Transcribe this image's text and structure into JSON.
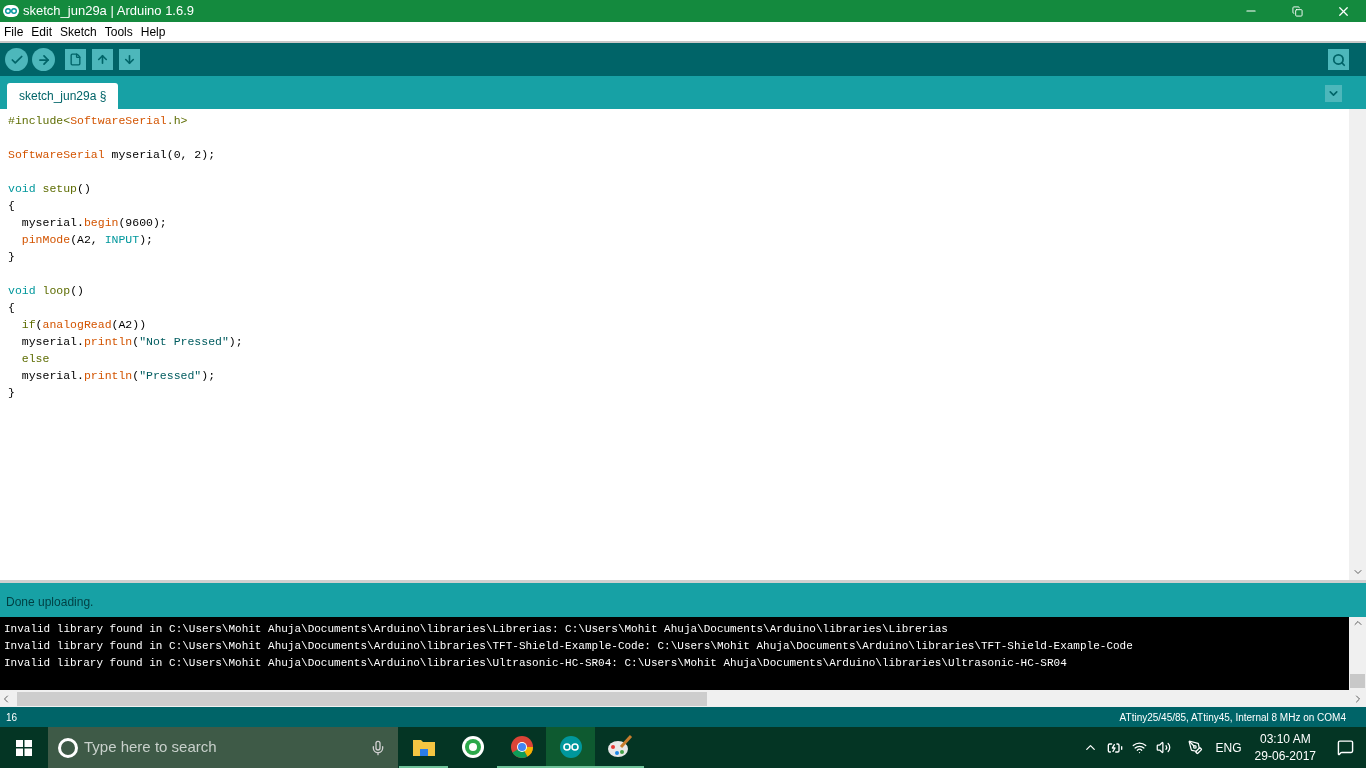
{
  "window": {
    "title": "sketch_jun29a | Arduino 1.6.9"
  },
  "menu": [
    "File",
    "Edit",
    "Sketch",
    "Tools",
    "Help"
  ],
  "tabs": [
    {
      "label": "sketch_jun29a §",
      "selected": true
    }
  ],
  "code": [
    {
      "kind": "code",
      "tokens": [
        {
          "kind": "keyword",
          "text": "#include<"
        },
        {
          "kind": "type",
          "text": "SoftwareSerial"
        },
        {
          "kind": "keyword",
          "text": ".h>"
        }
      ]
    },
    {
      "kind": "blank"
    },
    {
      "kind": "code",
      "tokens": [
        {
          "kind": "type",
          "text": "SoftwareSerial"
        },
        {
          "kind": "plain",
          "text": " myserial(0, 2);"
        }
      ]
    },
    {
      "kind": "blank"
    },
    {
      "kind": "code",
      "tokens": [
        {
          "kind": "datatype",
          "text": "void"
        },
        {
          "kind": "keyword",
          "text": " setup"
        },
        {
          "kind": "plain",
          "text": "()"
        }
      ]
    },
    {
      "tokens": [
        {
          "kind": "plain",
          "text": "{"
        }
      ]
    },
    {
      "tokens": [
        {
          "kind": "plain",
          "text": "  myserial."
        },
        {
          "kind": "type",
          "text": "begin"
        },
        {
          "kind": "plain",
          "text": "(9600);"
        }
      ]
    },
    {
      "kind": "code",
      "tokens": [
        {
          "kind": "type",
          "text": "  pinMode"
        },
        {
          "kind": "plain",
          "text": "(A2, "
        },
        {
          "kind": "datatype",
          "text": "INPUT"
        },
        {
          "kind": "plain",
          "text": ");"
        }
      ]
    },
    {
      "tokens": [
        {
          "kind": "plain",
          "text": "}"
        }
      ]
    },
    {
      "kind": "blank"
    },
    {
      "kind": "code",
      "tokens": [
        {
          "kind": "datatype",
          "text": "void"
        },
        {
          "kind": "keyword",
          "text": " loop"
        },
        {
          "kind": "plain",
          "text": "()"
        }
      ]
    },
    {
      "tokens": [
        {
          "kind": "plain",
          "text": "{"
        }
      ]
    },
    {
      "kind": "code",
      "tokens": [
        {
          "kind": "keyword",
          "text": "  if"
        },
        {
          "kind": "plain",
          "text": "("
        },
        {
          "kind": "type",
          "text": "analogRead"
        },
        {
          "kind": "plain",
          "text": "(A2))"
        }
      ]
    },
    {
      "tokens": [
        {
          "kind": "plain",
          "text": "  myserial."
        },
        {
          "kind": "type",
          "text": "println"
        },
        {
          "kind": "plain",
          "text": "("
        },
        {
          "kind": "string",
          "text": "\"Not Pressed\""
        },
        {
          "kind": "plain",
          "text": ");"
        }
      ]
    },
    {
      "kind": "code",
      "tokens": [
        {
          "kind": "keyword",
          "text": "  else"
        }
      ]
    },
    {
      "tokens": [
        {
          "kind": "plain",
          "text": "  myserial."
        },
        {
          "kind": "type",
          "text": "println"
        },
        {
          "kind": "plain",
          "text": "("
        },
        {
          "kind": "string",
          "text": "\"Pressed\""
        },
        {
          "kind": "plain",
          "text": ");"
        }
      ]
    },
    {
      "tokens": [
        {
          "kind": "plain",
          "text": "}"
        }
      ]
    }
  ],
  "status": "Done uploading.",
  "console": [
    "Invalid library found in C:\\Users\\Mohit Ahuja\\Documents\\Arduino\\libraries\\Librerias: C:\\Users\\Mohit Ahuja\\Documents\\Arduino\\libraries\\Librerias",
    "Invalid library found in C:\\Users\\Mohit Ahuja\\Documents\\Arduino\\libraries\\TFT-Shield-Example-Code: C:\\Users\\Mohit Ahuja\\Documents\\Arduino\\libraries\\TFT-Shield-Example-Code",
    "Invalid library found in C:\\Users\\Mohit Ahuja\\Documents\\Arduino\\libraries\\Ultrasonic-HC-SR04: C:\\Users\\Mohit Ahuja\\Documents\\Arduino\\libraries\\Ultrasonic-HC-SR04"
  ],
  "footer": {
    "line": "16",
    "board": "ATtiny25/45/85, ATtiny45, Internal 8 MHz on COM4"
  },
  "taskbar": {
    "search": {
      "placeholder": "Type here to search"
    },
    "apps": [
      {
        "kind": "folder",
        "running": true,
        "selected": false
      },
      {
        "kind": "chat",
        "running": false,
        "selected": false
      },
      {
        "kind": "browser",
        "running": true,
        "selected": false
      },
      {
        "kind": "arduino",
        "running": true,
        "selected": true
      },
      {
        "kind": "paint",
        "running": true,
        "selected": false
      }
    ],
    "language": "ENG",
    "time": "03:10 AM",
    "date": "29-06-2017"
  }
}
